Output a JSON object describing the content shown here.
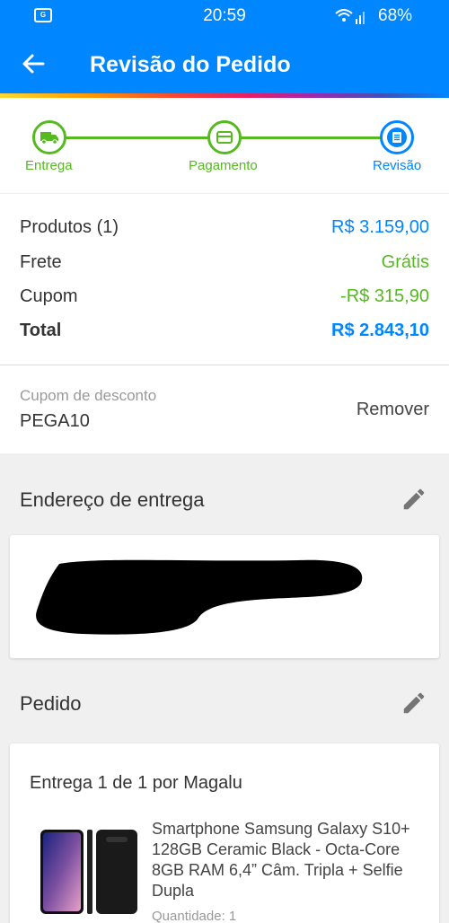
{
  "status_bar": {
    "time": "20:59",
    "battery": "68%",
    "notification_icon": "app-notification-icon",
    "wifi_icon": "wifi-signal-icon"
  },
  "app_bar": {
    "title": "Revisão do Pedido",
    "back_icon": "arrow-left-icon"
  },
  "stepper": {
    "steps": [
      {
        "label": "Entrega",
        "icon": "truck-icon",
        "state": "done"
      },
      {
        "label": "Pagamento",
        "icon": "credit-card-icon",
        "state": "done"
      },
      {
        "label": "Revisão",
        "icon": "document-icon",
        "state": "active"
      }
    ]
  },
  "summary": {
    "rows": [
      {
        "label": "Produtos (1)",
        "value": "R$ 3.159,00",
        "color": "#0086ff"
      },
      {
        "label": "Frete",
        "value": "Grátis",
        "color": "#56b920"
      },
      {
        "label": "Cupom",
        "value": "-R$ 315,90",
        "color": "#56b920"
      }
    ],
    "total": {
      "label": "Total",
      "value": "R$ 2.843,10"
    }
  },
  "coupon": {
    "label": "Cupom de desconto",
    "code": "PEGA10",
    "remove_label": "Remover"
  },
  "address": {
    "title": "Endereço de entrega",
    "edit_icon": "pencil-icon"
  },
  "order": {
    "title": "Pedido",
    "edit_icon": "pencil-icon",
    "delivery_title": "Entrega 1 de 1 por Magalu",
    "product": {
      "name": "Smartphone Samsung Galaxy S10+ 128GB Ceramic Black - Octa-Core 8GB RAM 6,4” Câm. Tripla + Selfie Dupla",
      "quantity": "Quantidade: 1"
    }
  },
  "colors": {
    "primary": "#0086ff",
    "success": "#56b920",
    "background": "#f0f0f0"
  }
}
